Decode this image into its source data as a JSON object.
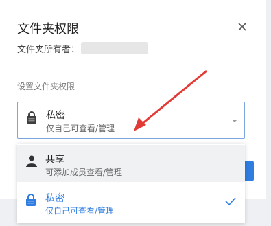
{
  "dialog": {
    "title": "文件夹权限",
    "owner_label": "文件夹所有者：",
    "section_label": "设置文件夹权限"
  },
  "select": {
    "selected_main": "私密",
    "selected_sub": "仅自己可查看/管理"
  },
  "options": [
    {
      "main": "共享",
      "sub": "可添加成员查看/管理",
      "icon": "person-icon",
      "selected": false
    },
    {
      "main": "私密",
      "sub": "仅自己可查看/管理",
      "icon": "lock-icon",
      "selected": true
    }
  ],
  "colors": {
    "accent": "#2f7de1",
    "annotation_arrow": "#e23b35"
  }
}
